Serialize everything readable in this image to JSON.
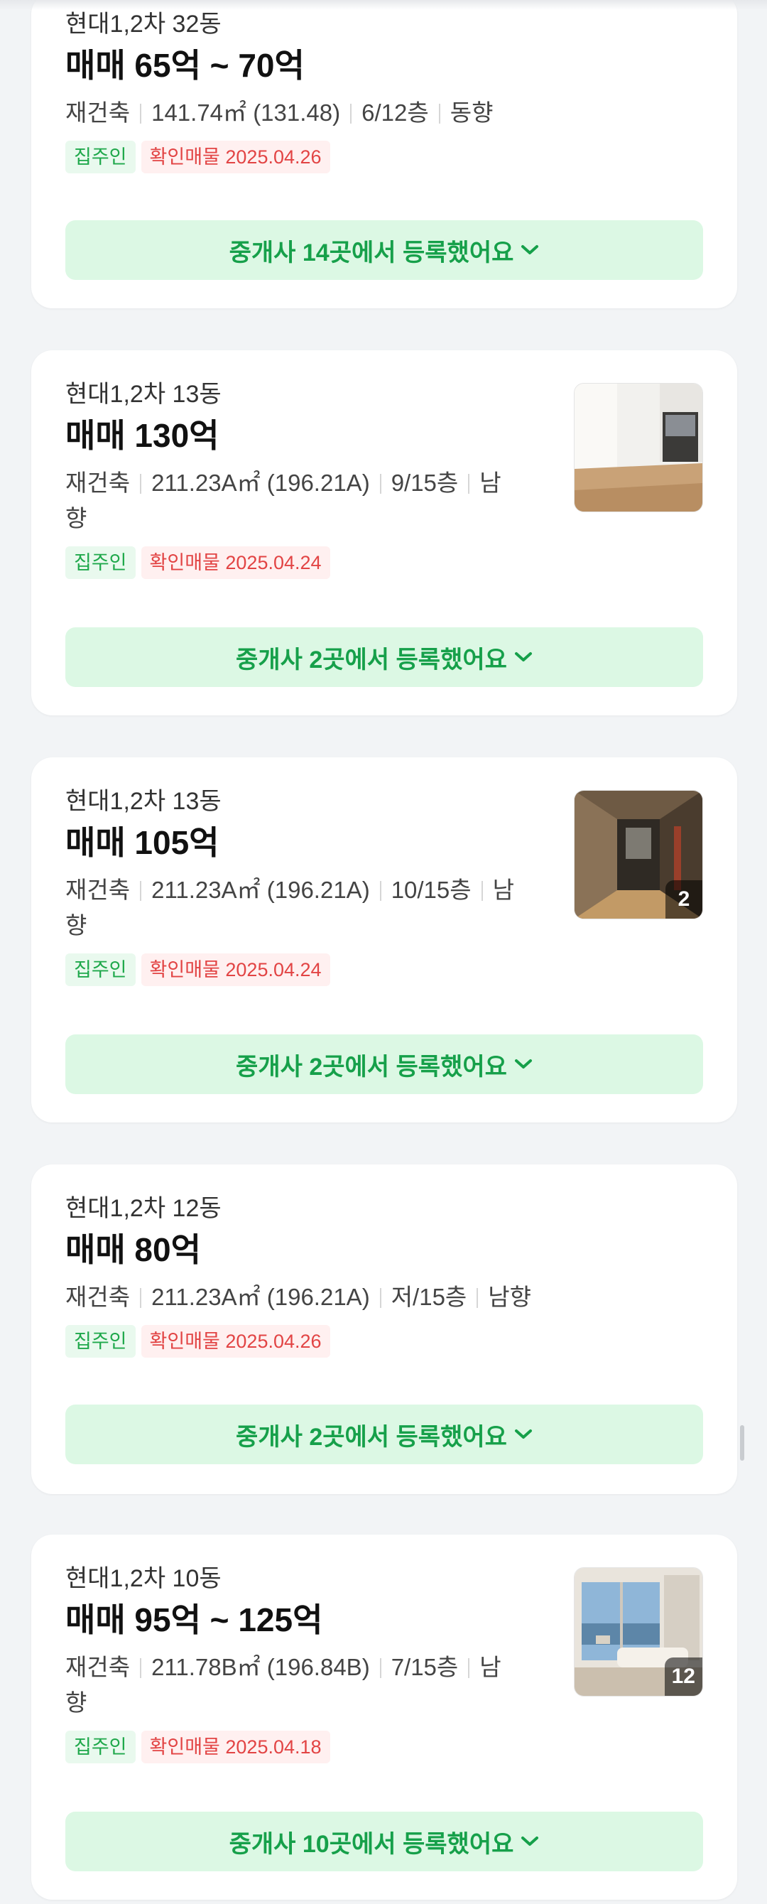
{
  "listings": [
    {
      "building": "현대1,2차 32동",
      "price": "매매 65억 ~ 70억",
      "spec": [
        "재건축",
        "141.74㎡ (131.48)",
        "6/12층",
        "동향"
      ],
      "tags": {
        "owner": "집주인",
        "verified": "확인매물 2025.04.26"
      },
      "agent_button": "중개사 14곳에서 등록했어요",
      "photo": null
    },
    {
      "building": "현대1,2차 13동",
      "price": "매매 130억",
      "spec": [
        "재건축",
        "211.23A㎡ (196.21A)",
        "9/15층",
        "남향"
      ],
      "tags": {
        "owner": "집주인",
        "verified": "확인매물 2025.04.24"
      },
      "agent_button": "중개사 2곳에서 등록했어요",
      "photo": {
        "count": ""
      }
    },
    {
      "building": "현대1,2차 13동",
      "price": "매매 105억",
      "spec": [
        "재건축",
        "211.23A㎡ (196.21A)",
        "10/15층",
        "남향"
      ],
      "tags": {
        "owner": "집주인",
        "verified": "확인매물 2025.04.24"
      },
      "agent_button": "중개사 2곳에서 등록했어요",
      "photo": {
        "count": "2"
      }
    },
    {
      "building": "현대1,2차 12동",
      "price": "매매 80억",
      "spec": [
        "재건축",
        "211.23A㎡ (196.21A)",
        "저/15층",
        "남향"
      ],
      "tags": {
        "owner": "집주인",
        "verified": "확인매물 2025.04.26"
      },
      "agent_button": "중개사 2곳에서 등록했어요",
      "photo": null
    },
    {
      "building": "현대1,2차 10동",
      "price": "매매 95억 ~ 125억",
      "spec": [
        "재건축",
        "211.78B㎡ (196.84B)",
        "7/15층",
        "남향"
      ],
      "tags": {
        "owner": "집주인",
        "verified": "확인매물 2025.04.18"
      },
      "agent_button": "중개사 10곳에서 등록했어요",
      "photo": {
        "count": "12"
      }
    }
  ],
  "colors": {
    "background": "#f2f4f6",
    "accent_green": "#16a04a",
    "button_bg": "#dcf8e4",
    "tag_red": "#e24444"
  },
  "icons": {
    "expand": "chevron-down-icon"
  }
}
